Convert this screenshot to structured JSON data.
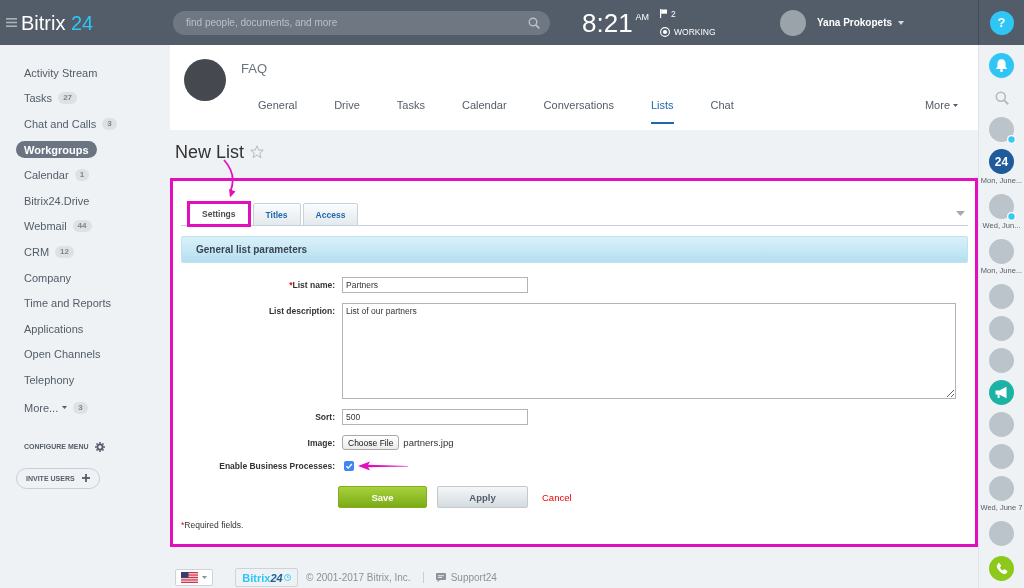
{
  "top_bar": {
    "logo": {
      "name": "Bitrix",
      "number": "24"
    },
    "search": {
      "placeholder": "find people, documents, and more"
    },
    "clock": {
      "time": "8:21",
      "period": "AM"
    },
    "flags": {
      "count": "2"
    },
    "work_status": "WORKING",
    "user": {
      "name": "Yana Prokopets"
    },
    "help": "?"
  },
  "sidebar": {
    "items": [
      {
        "label": "Activity Stream",
        "kind": "link",
        "selected": false
      },
      {
        "label": "Tasks",
        "count": "27",
        "kind": "link",
        "selected": false
      },
      {
        "label": "Chat and Calls",
        "count": "3",
        "kind": "link",
        "selected": false
      },
      {
        "label": "Workgroups",
        "kind": "link",
        "selected": true
      },
      {
        "label": "Calendar",
        "count": "1",
        "kind": "link",
        "selected": false
      },
      {
        "label": "Bitrix24.Drive",
        "kind": "link",
        "selected": false
      },
      {
        "label": "Webmail",
        "count": "44",
        "kind": "link",
        "selected": false
      },
      {
        "label": "CRM",
        "count": "12",
        "kind": "link",
        "selected": false
      },
      {
        "label": "Company",
        "kind": "link",
        "selected": false
      },
      {
        "label": "Time and Reports",
        "kind": "link",
        "selected": false
      },
      {
        "label": "Applications",
        "kind": "link",
        "selected": false
      },
      {
        "label": "Open Channels",
        "kind": "link",
        "selected": false
      },
      {
        "label": "Telephony",
        "kind": "link",
        "selected": false
      },
      {
        "label": "More...",
        "count": "3",
        "kind": "more",
        "selected": false
      }
    ],
    "configure": "CONFIGURE MENU",
    "invite": "INVITE USERS"
  },
  "group": {
    "name": "FAQ",
    "tabs": [
      {
        "label": "General",
        "selected": false
      },
      {
        "label": "Drive",
        "selected": false
      },
      {
        "label": "Tasks",
        "selected": false
      },
      {
        "label": "Calendar",
        "selected": false
      },
      {
        "label": "Conversations",
        "selected": false
      },
      {
        "label": "Lists",
        "selected": true
      },
      {
        "label": "Chat",
        "selected": false
      }
    ],
    "more": "More"
  },
  "page_title": "New List",
  "form": {
    "highlighted": true,
    "tabs": [
      {
        "label": "Settings",
        "selected": true,
        "highlighted": true,
        "arrow": true
      },
      {
        "label": "Titles",
        "selected": false,
        "highlighted": false,
        "arrow": false
      },
      {
        "label": "Access",
        "selected": false,
        "highlighted": false,
        "arrow": false
      }
    ],
    "section": "General list parameters",
    "fields": [
      {
        "kind": "text",
        "required_mark": "*",
        "label": "List name:",
        "value": "Partners"
      },
      {
        "kind": "textarea",
        "label": "List description:",
        "value": "List of our partners"
      },
      {
        "kind": "text",
        "label": "Sort:",
        "value": "500"
      },
      {
        "kind": "file",
        "label": "Image:",
        "button": "Choose File",
        "value": "partners.jpg"
      },
      {
        "kind": "checkbox",
        "label": "Enable Business Processes:",
        "checked": true,
        "arrow": true
      }
    ],
    "buttons": [
      {
        "kind": "primary",
        "label": "Save"
      },
      {
        "kind": "secondary",
        "label": "Apply"
      },
      {
        "kind": "link",
        "label": "Cancel"
      }
    ],
    "note": {
      "mark": "*",
      "text": "Required fields."
    }
  },
  "footer": {
    "logo": {
      "name": "Bitrix",
      "number": "24"
    },
    "copyright": "© 2001-2017 Bitrix, Inc.",
    "support": "Support24"
  },
  "right_rail": {
    "items": [
      {
        "kind": "bell"
      },
      {
        "kind": "search"
      },
      {
        "kind": "avatar",
        "badge": true
      },
      {
        "kind": "logo",
        "text": "24",
        "caption": "Mon, June..."
      },
      {
        "kind": "avatar",
        "badge": true,
        "caption": "Wed, Jun..."
      },
      {
        "kind": "avatar",
        "badge": false,
        "caption": "Mon, June..."
      },
      {
        "kind": "avatar",
        "badge": false
      },
      {
        "kind": "avatar",
        "badge": false
      },
      {
        "kind": "avatar",
        "badge": false
      },
      {
        "kind": "megaphone"
      },
      {
        "kind": "avatar",
        "badge": false
      },
      {
        "kind": "avatar",
        "badge": false
      },
      {
        "kind": "avatar",
        "badge": false,
        "caption": "Wed, June 7"
      },
      {
        "kind": "avatar",
        "badge": false
      },
      {
        "kind": "phone"
      }
    ]
  }
}
